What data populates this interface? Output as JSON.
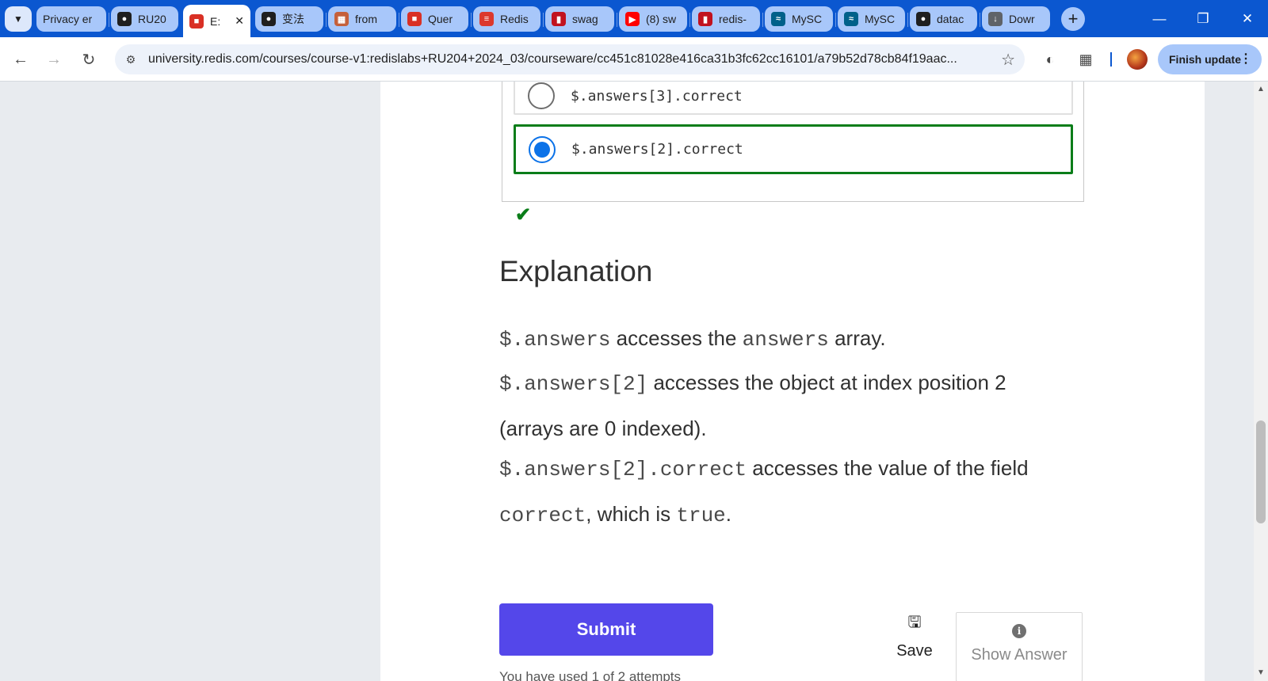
{
  "browser": {
    "tabs": [
      {
        "title": "Privacy er",
        "favicon": "privacy-icon",
        "color": "#a8c7fa"
      },
      {
        "title": "RU20",
        "favicon": "github-icon",
        "color": "#1f1f1f"
      },
      {
        "title": "E:",
        "favicon": "redis-cube-icon",
        "color": "#d93025",
        "active": true
      },
      {
        "title": "变法",
        "favicon": "chat-bot-icon",
        "color": "#1f1f1f"
      },
      {
        "title": "from",
        "favicon": "cube-grid-icon",
        "color": "#c5603b"
      },
      {
        "title": "Quer",
        "favicon": "redis-cube-icon",
        "color": "#d93025"
      },
      {
        "title": "Redis",
        "favicon": "redis-logo-icon",
        "color": "#dc382d"
      },
      {
        "title": "swag",
        "favicon": "stack-icon",
        "color": "#c1121f"
      },
      {
        "title": "(8) sw",
        "favicon": "youtube-icon",
        "color": "#ff0000"
      },
      {
        "title": "redis-",
        "favicon": "stack-icon",
        "color": "#c1121f"
      },
      {
        "title": "MySC",
        "favicon": "mysql-icon",
        "color": "#00618a"
      },
      {
        "title": "MySC",
        "favicon": "mysql-icon",
        "color": "#00618a"
      },
      {
        "title": "datac",
        "favicon": "github-icon",
        "color": "#1f1f1f"
      },
      {
        "title": "Dowr",
        "favicon": "download-icon",
        "color": "#5f6368"
      }
    ],
    "url": "university.redis.com/courses/course-v1:redislabs+RU204+2024_03/courseware/cc451c81028e416ca31b3fc62cc16101/a79b52d78cb84f19aac...",
    "finish_update": "Finish update"
  },
  "quiz": {
    "choices": [
      {
        "label": "$.answers[3].correct",
        "selected": false
      },
      {
        "label": "$.answers[2].correct",
        "selected": true
      }
    ],
    "result": "correct",
    "explanation_title": "Explanation",
    "p1": {
      "code1": "$.answers",
      "text1": " accesses the ",
      "code2": "answers",
      "text2": " array."
    },
    "p2": {
      "code1": "$.answers[2]",
      "text1": " accesses the object at index position 2 (arrays are 0 indexed)."
    },
    "p3": {
      "code1": "$.answers[2].correct",
      "text1": " accesses the value of the field ",
      "code2": "correct",
      "text2": ", which is ",
      "code3": "true",
      "text3": "."
    },
    "submit_label": "Submit",
    "save_label": "Save",
    "show_answer_label": "Show Answer",
    "attempts_text": "You have used 1 of 2 attempts"
  },
  "colors": {
    "tabstrip": "#0b57d0",
    "submit": "#5447ea",
    "correct": "#0a7d19",
    "radio_selected": "#0b72e8"
  }
}
